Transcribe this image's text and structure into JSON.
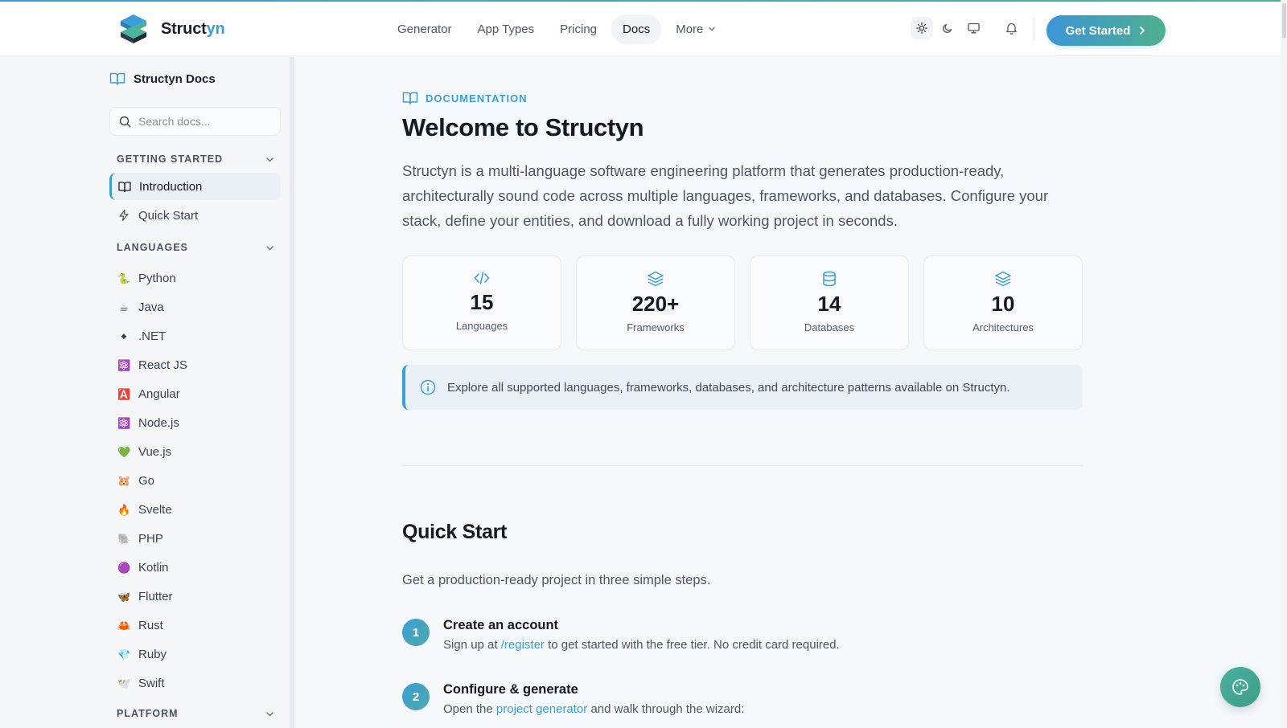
{
  "brand": {
    "name_main": "Struct",
    "name_accent": "yn"
  },
  "nav": {
    "links": [
      {
        "label": "Generator"
      },
      {
        "label": "App Types"
      },
      {
        "label": "Pricing"
      },
      {
        "label": "Docs",
        "active": true
      },
      {
        "label": "More",
        "dropdown": true
      }
    ],
    "theme_icons": [
      "sun-icon",
      "moon-icon",
      "monitor-icon"
    ],
    "notification_icon": "bell-icon",
    "cta_label": "Get Started"
  },
  "sidebar": {
    "title": "Structyn Docs",
    "search_placeholder": "Search docs...",
    "sections": [
      {
        "label": "GETTING STARTED"
      },
      {
        "label": "LANGUAGES"
      },
      {
        "label": "PLATFORM"
      }
    ],
    "getting_started": [
      {
        "label": "Introduction",
        "icon": "book-icon",
        "active": true
      },
      {
        "label": "Quick Start",
        "icon": "lightning-icon"
      }
    ],
    "languages": [
      {
        "label": "Python",
        "emoji": "🐍"
      },
      {
        "label": "Java",
        "emoji": "☕"
      },
      {
        "label": ".NET",
        "emoji": "◆"
      },
      {
        "label": "React JS",
        "emoji": "⚛️"
      },
      {
        "label": "Angular",
        "emoji": "🅰️"
      },
      {
        "label": "Node.js",
        "emoji": "⚛️"
      },
      {
        "label": "Vue.js",
        "emoji": "💚"
      },
      {
        "label": "Go",
        "emoji": "🐹"
      },
      {
        "label": "Svelte",
        "emoji": "🔥"
      },
      {
        "label": "PHP",
        "emoji": "🐘"
      },
      {
        "label": "Kotlin",
        "emoji": "🟣"
      },
      {
        "label": "Flutter",
        "emoji": "🦋"
      },
      {
        "label": "Rust",
        "emoji": "🦀"
      },
      {
        "label": "Ruby",
        "emoji": "💎"
      },
      {
        "label": "Swift",
        "emoji": "🕊️"
      }
    ]
  },
  "main": {
    "eyebrow": "DOCUMENTATION",
    "title": "Welcome to Structyn",
    "lead": "Structyn is a multi-language software engineering platform that generates production-ready, architecturally sound code across multiple languages, frameworks, and databases. Configure your stack, define your entities, and download a fully working project in seconds.",
    "stats": [
      {
        "value": "15",
        "label": "Languages",
        "icon": "code-icon"
      },
      {
        "value": "220+",
        "label": "Frameworks",
        "icon": "layers-icon"
      },
      {
        "value": "14",
        "label": "Databases",
        "icon": "database-icon"
      },
      {
        "value": "10",
        "label": "Architectures",
        "icon": "layers-icon"
      }
    ],
    "callout": "Explore all supported languages, frameworks, databases, and architecture patterns available on Structyn.",
    "quickstart": {
      "title": "Quick Start",
      "subtitle": "Get a production-ready project in three simple steps.",
      "steps": [
        {
          "num": "1",
          "title": "Create an account",
          "pre": "Sign up at ",
          "link": "/register",
          "post": " to get started with the free tier. No credit card required."
        },
        {
          "num": "2",
          "title": "Configure & generate",
          "pre": "Open the ",
          "link": "project generator",
          "post": " and walk through the wizard:"
        }
      ]
    }
  },
  "colors": {
    "accent": "#3b9ed9",
    "accent_green": "#4fb08f"
  },
  "fab_icon": "palette-icon"
}
